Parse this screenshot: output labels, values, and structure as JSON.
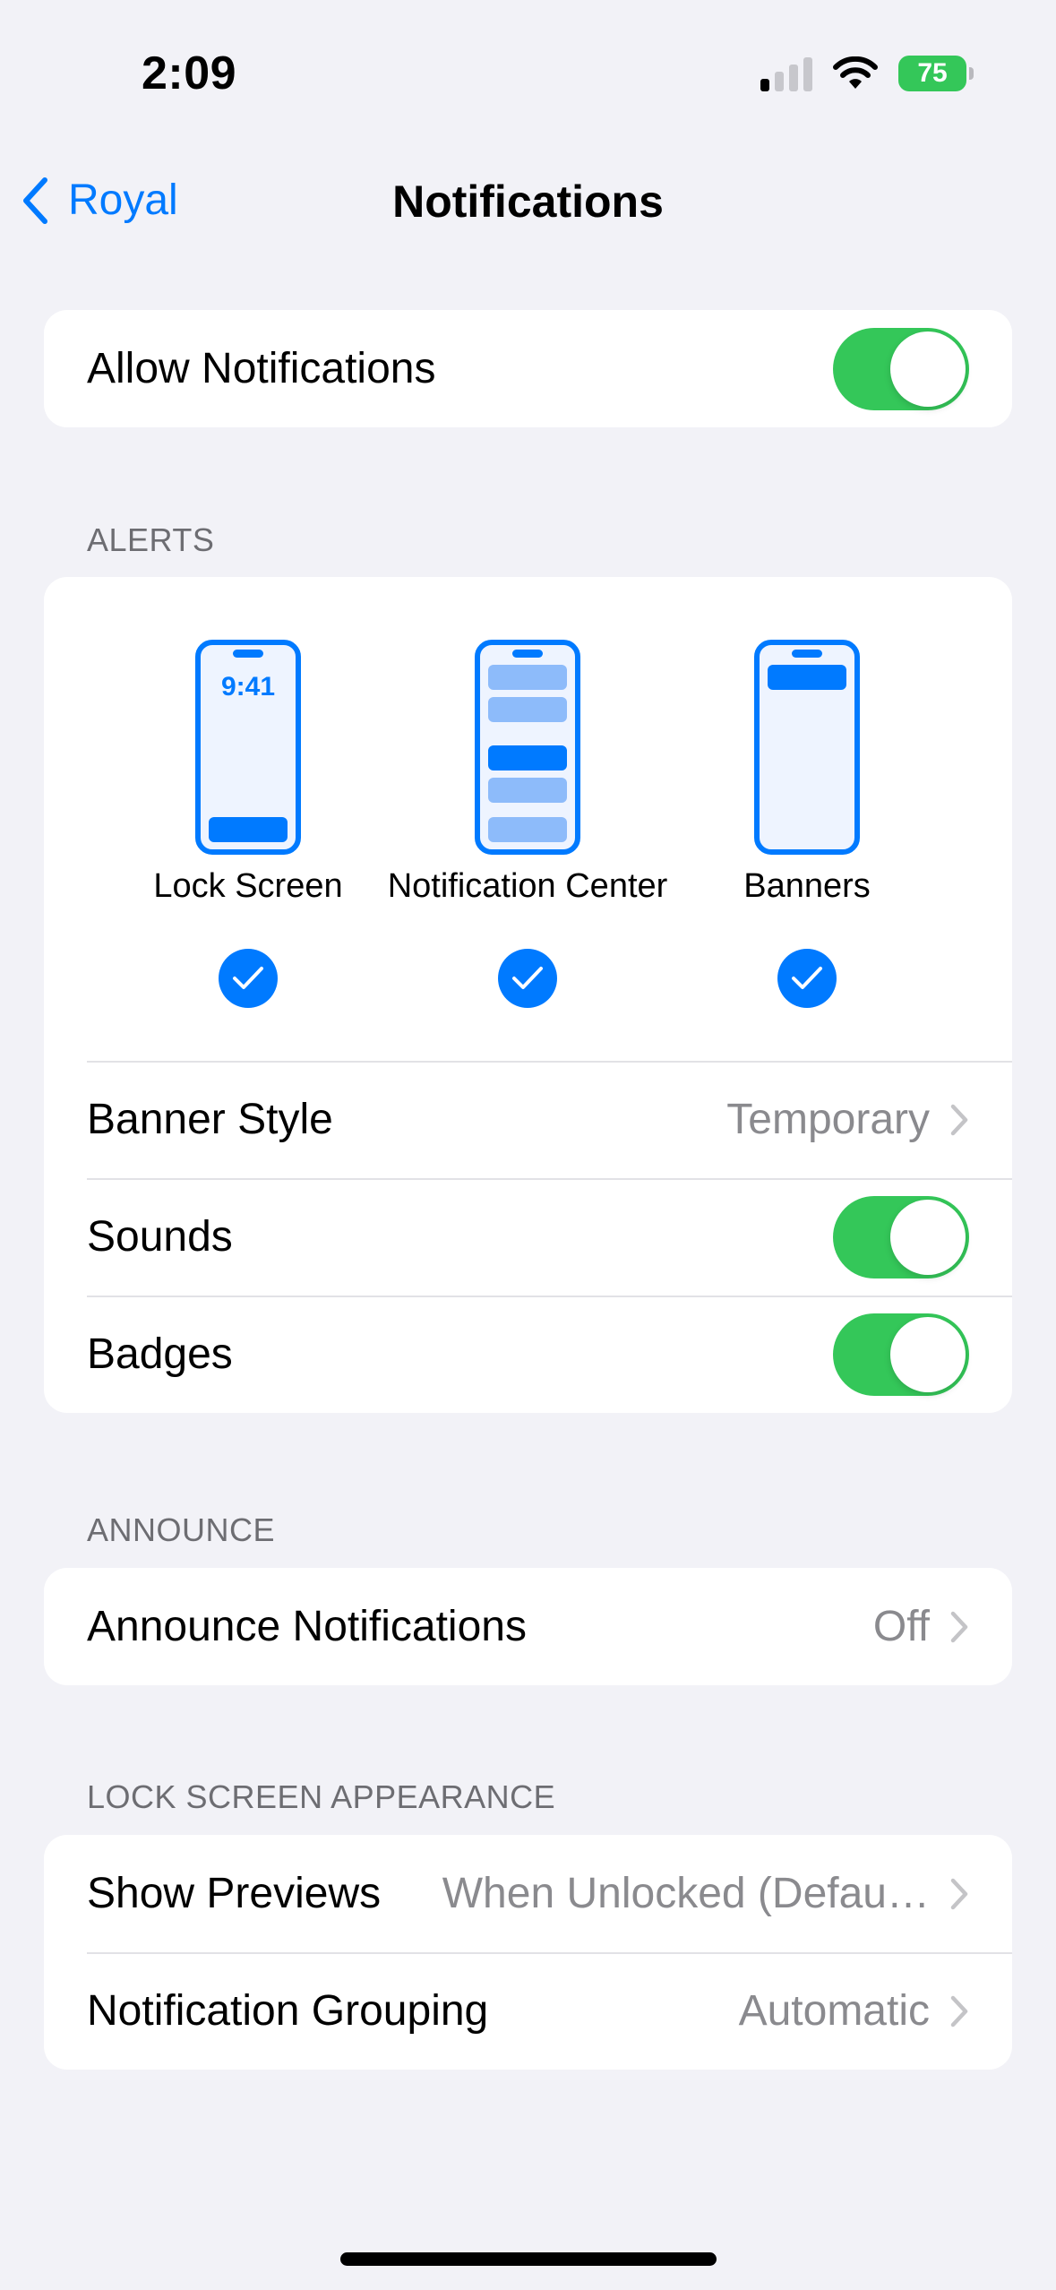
{
  "status_bar": {
    "time": "2:09",
    "battery": "75",
    "signal_bars_active": 1,
    "signal_bars_total": 4
  },
  "nav": {
    "back_label": "Royal",
    "title": "Notifications"
  },
  "allow_notifications": {
    "label": "Allow Notifications",
    "enabled": true
  },
  "alerts": {
    "header": "ALERTS",
    "options": [
      {
        "label": "Lock Screen",
        "checked": true,
        "icon": "lock-screen-phone-icon",
        "screen_time": "9:41"
      },
      {
        "label": "Notification Center",
        "checked": true,
        "icon": "notification-center-phone-icon"
      },
      {
        "label": "Banners",
        "checked": true,
        "icon": "banners-phone-icon"
      }
    ],
    "banner_style": {
      "label": "Banner Style",
      "value": "Temporary"
    },
    "sounds": {
      "label": "Sounds",
      "enabled": true
    },
    "badges": {
      "label": "Badges",
      "enabled": true
    }
  },
  "announce": {
    "header": "ANNOUNCE",
    "announce_notifications": {
      "label": "Announce Notifications",
      "value": "Off"
    }
  },
  "lock_screen_appearance": {
    "header": "LOCK SCREEN APPEARANCE",
    "show_previews": {
      "label": "Show Previews",
      "value": "When Unlocked (Defau…"
    },
    "notification_grouping": {
      "label": "Notification Grouping",
      "value": "Automatic"
    }
  },
  "colors": {
    "accent": "#007AFF",
    "toggle_on": "#34C759",
    "background": "#F2F2F7",
    "secondary_text": "#8A8A8E"
  }
}
